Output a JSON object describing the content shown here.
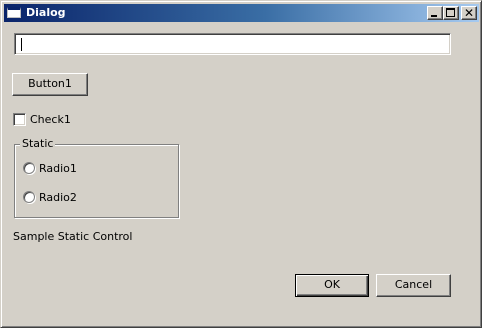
{
  "window": {
    "title": "Dialog",
    "icon": "window-app-icon",
    "controls": {
      "minimize_icon": "minimize-icon",
      "maximize_icon": "maximize-icon",
      "close_symbol": "✕"
    },
    "colors": {
      "titlebar_start": "#0a246a",
      "titlebar_end": "#a6caf0",
      "face": "#d4d0c8"
    }
  },
  "edit": {
    "value": "",
    "placeholder": ""
  },
  "button1": {
    "label": "Button1"
  },
  "check1": {
    "label": "Check1",
    "checked": false
  },
  "group": {
    "caption": "Static",
    "radios": [
      {
        "label": "Radio1",
        "selected": false
      },
      {
        "label": "Radio2",
        "selected": false
      }
    ]
  },
  "static_text": "Sample Static Control",
  "footer": {
    "ok_label": "OK",
    "cancel_label": "Cancel"
  }
}
